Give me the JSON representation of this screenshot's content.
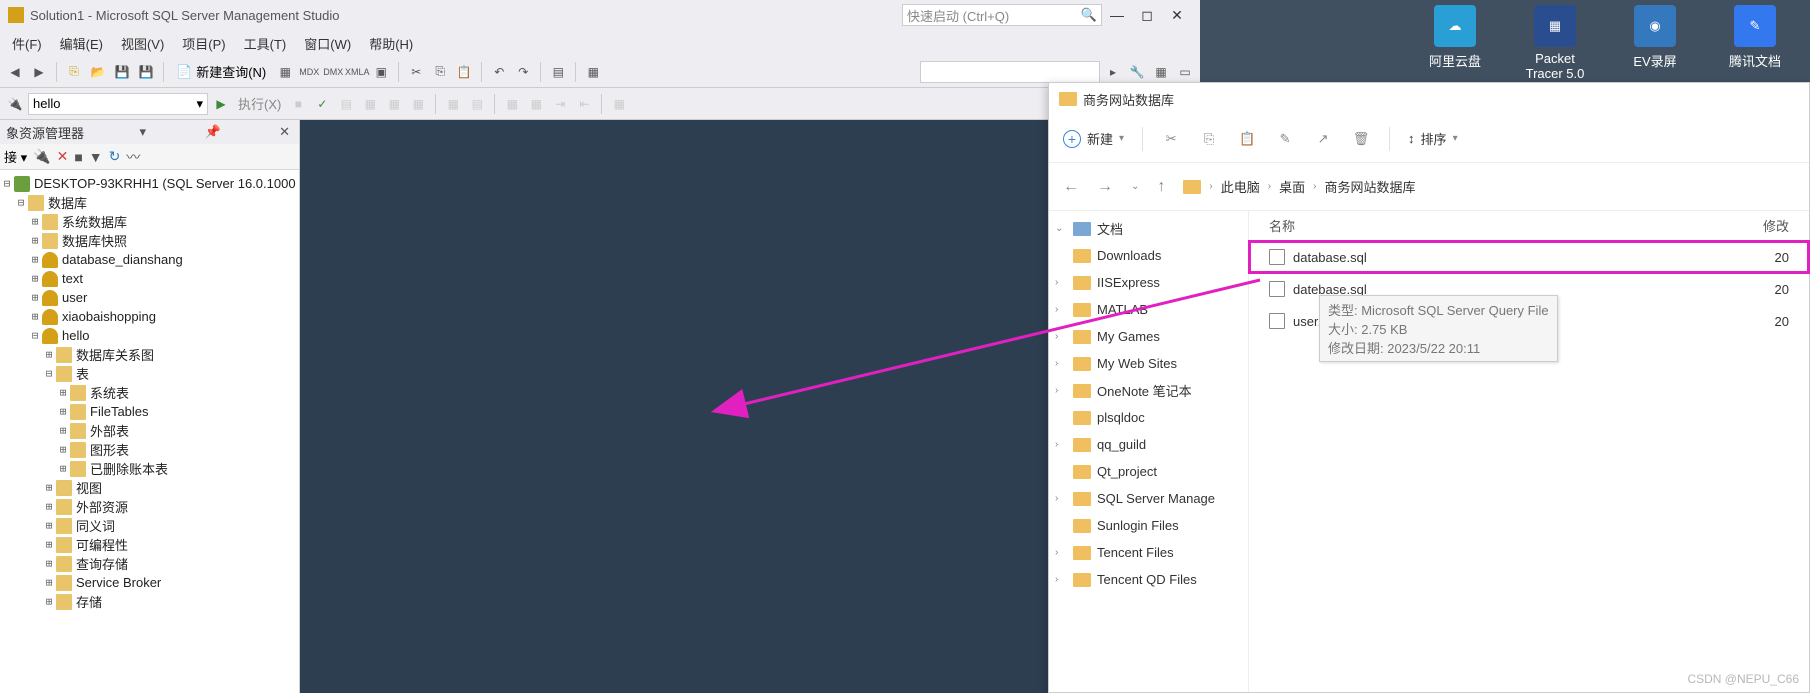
{
  "ssms": {
    "title": "Solution1 - Microsoft SQL Server Management Studio",
    "quick_launch": "快速启动 (Ctrl+Q)",
    "menu": [
      "件(F)",
      "编辑(E)",
      "视图(V)",
      "项目(P)",
      "工具(T)",
      "窗口(W)",
      "帮助(H)"
    ],
    "new_query": "新建查询(N)",
    "db_selected": "hello",
    "execute": "执行(X)",
    "explorer_title": "象资源管理器",
    "connect_label": "接 ▾",
    "tree": {
      "server": "DESKTOP-93KRHH1 (SQL Server 16.0.1000",
      "databases": "数据库",
      "sys_db": "系统数据库",
      "db_snap": "数据库快照",
      "db1": "database_dianshang",
      "db2": "text",
      "db3": "user",
      "db4": "xiaobaishopping",
      "db5": "hello",
      "diagram": "数据库关系图",
      "tables": "表",
      "sys_tables": "系统表",
      "filetables": "FileTables",
      "ext_tables": "外部表",
      "graph_tables": "图形表",
      "deleted": "已删除账本表",
      "views": "视图",
      "ext_res": "外部资源",
      "synonyms": "同义词",
      "programmability": "可编程性",
      "query_store": "查询存储",
      "service_broker": "Service Broker",
      "storage": "存储"
    }
  },
  "explorer": {
    "title": "商务网站数据库",
    "new_btn": "新建",
    "sort_btn": "排序",
    "crumb": [
      "此电脑",
      "桌面",
      "商务网站数据库"
    ],
    "side_header": "文档",
    "side": [
      "Downloads",
      "IISExpress",
      "MATLAB",
      "My Games",
      "My Web Sites",
      "OneNote 笔记本",
      "plsqldoc",
      "qq_guild",
      "Qt_project",
      "SQL Server Manage",
      "Sunlogin Files",
      "Tencent Files",
      "Tencent QD Files"
    ],
    "col_name": "名称",
    "col_mod": "修改",
    "files": [
      {
        "name": "database.sql",
        "date": "20",
        "hl": true
      },
      {
        "name": "datebase.sql",
        "date": "20"
      },
      {
        "name": "user.sql",
        "date": "20"
      }
    ],
    "tooltip": {
      "l1": "类型: Microsoft SQL Server Query File",
      "l2": "大小: 2.75 KB",
      "l3": "修改日期: 2023/5/22 20:11"
    }
  },
  "desktop": [
    {
      "name": "阿里云盘"
    },
    {
      "name": "Packet Tracer 5.0"
    },
    {
      "name": "EV录屏"
    },
    {
      "name": "腾讯文档"
    }
  ],
  "watermark": "CSDN @NEPU_C66"
}
